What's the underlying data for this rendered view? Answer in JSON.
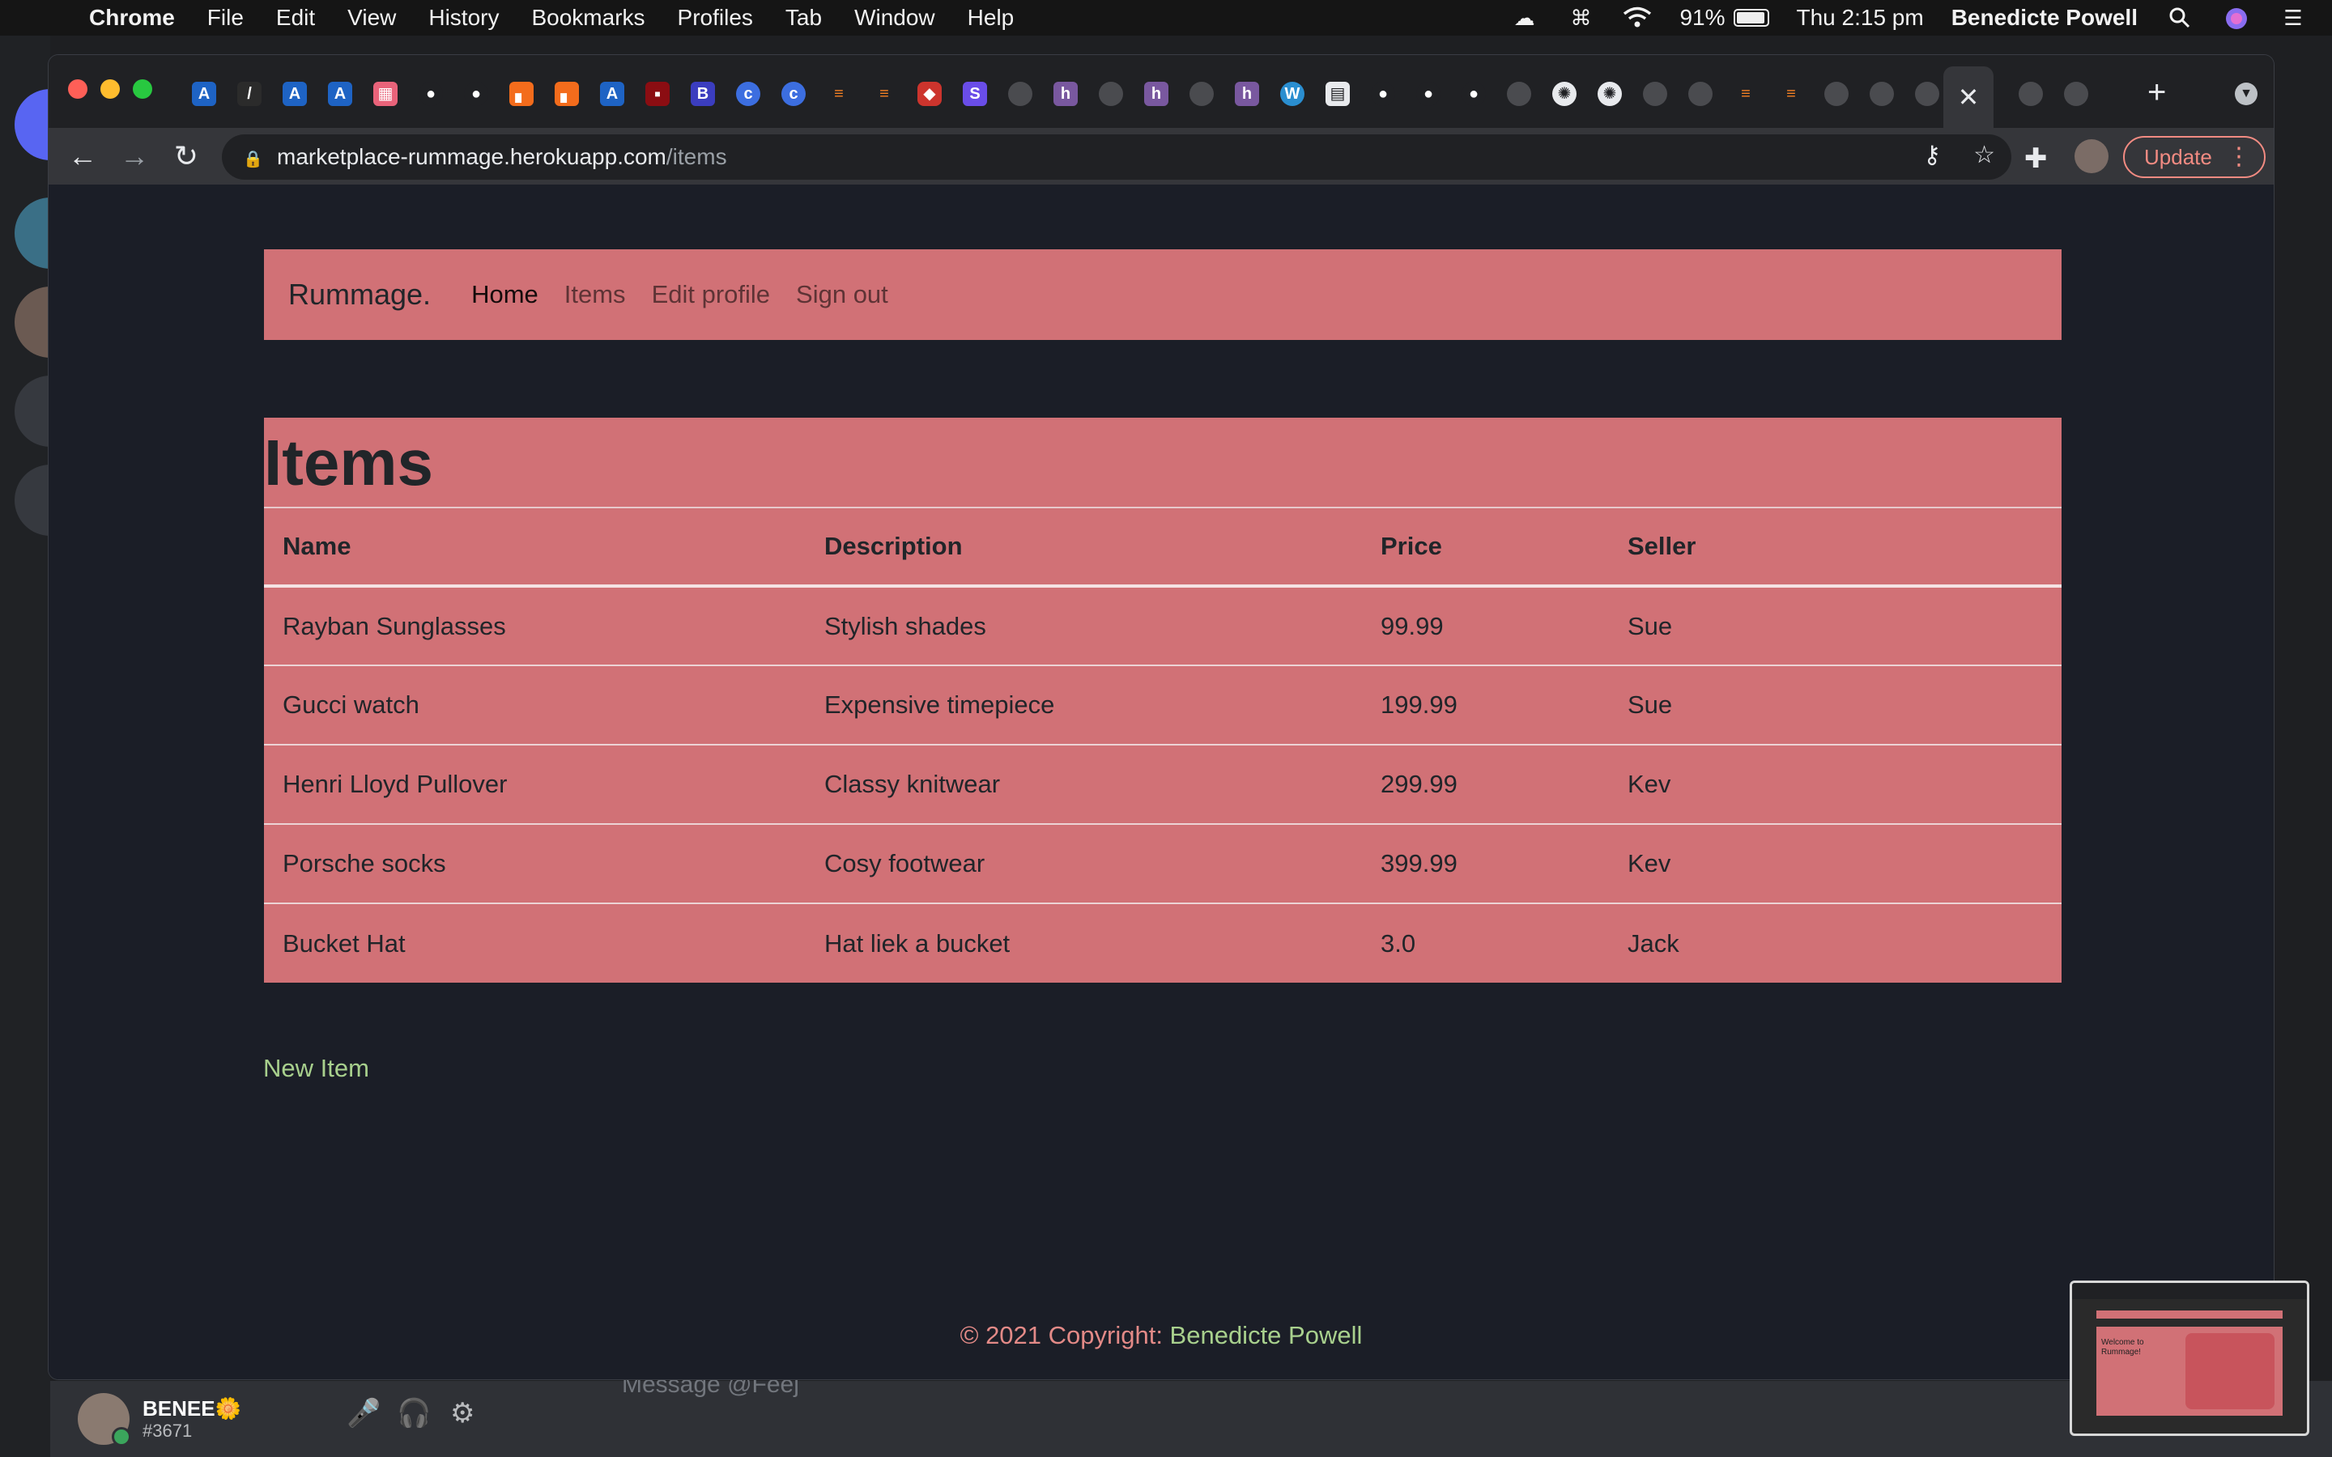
{
  "menubar": {
    "app_name": "Chrome",
    "items": [
      "File",
      "Edit",
      "View",
      "History",
      "Bookmarks",
      "Profiles",
      "Tab",
      "Window",
      "Help"
    ],
    "battery": "91%",
    "clock": "Thu 2:15 pm",
    "user": "Benedicte Powell"
  },
  "browser": {
    "url_host": "marketplace-rummage.herokuapp.com",
    "url_path": "/items",
    "update_label": "Update",
    "tab_close": "✕"
  },
  "navbar": {
    "brand": "Rummage.",
    "links": [
      "Home",
      "Items",
      "Edit profile",
      "Sign out"
    ]
  },
  "items": {
    "title": "Items",
    "headers": [
      "Name",
      "Description",
      "Price",
      "Seller"
    ],
    "rows": [
      [
        "Rayban Sunglasses",
        "Stylish shades",
        "99.99",
        "Sue"
      ],
      [
        "Gucci watch",
        "Expensive timepiece",
        "199.99",
        "Sue"
      ],
      [
        "Henri Lloyd Pullover",
        "Classy knitwear",
        "299.99",
        "Kev"
      ],
      [
        "Porsche socks",
        "Cosy footwear",
        "399.99",
        "Kev"
      ],
      [
        "Bucket Hat",
        "Hat liek a bucket",
        "3.0",
        "Jack"
      ]
    ],
    "new_item": "New Item"
  },
  "footer": {
    "prefix": "© 2021 Copyright: ",
    "author": "Benedicte Powell"
  },
  "discord": {
    "username": "BENEE🌼",
    "tag": "#3671",
    "message_placeholder": "Message @Feej"
  },
  "thumbnail": {
    "text": "Welcome to Rummage!"
  }
}
